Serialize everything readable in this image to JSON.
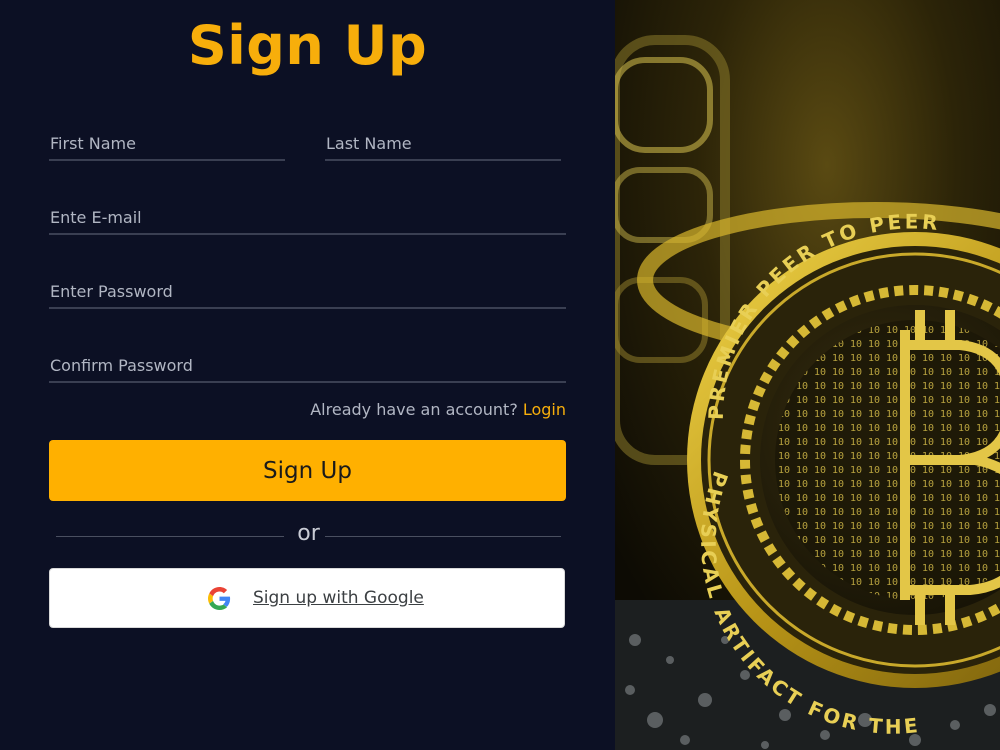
{
  "title": "Sign Up",
  "form": {
    "first_name_placeholder": "First Name",
    "last_name_placeholder": "Last Name",
    "email_placeholder": "Ente E-mail",
    "password_placeholder": "Enter Password",
    "confirm_password_placeholder": "Confirm Password"
  },
  "login_prompt": {
    "text": "Already have an account?",
    "link": "Login"
  },
  "signup_button": "Sign Up",
  "divider_text": "or",
  "google_button": "Sign up with Google",
  "coin": {
    "top_text": "PREMIER PEER TO PEER",
    "bottom_text": "PHYSICAL ARTIFACT FOR THE"
  },
  "colors": {
    "background": "#0c1024",
    "accent": "#f7ae0b",
    "button": "#ffb000",
    "field_underline": "#3a3f52"
  },
  "icons": {
    "google": "google-g-icon",
    "coin": "bitcoin-coin-image"
  }
}
